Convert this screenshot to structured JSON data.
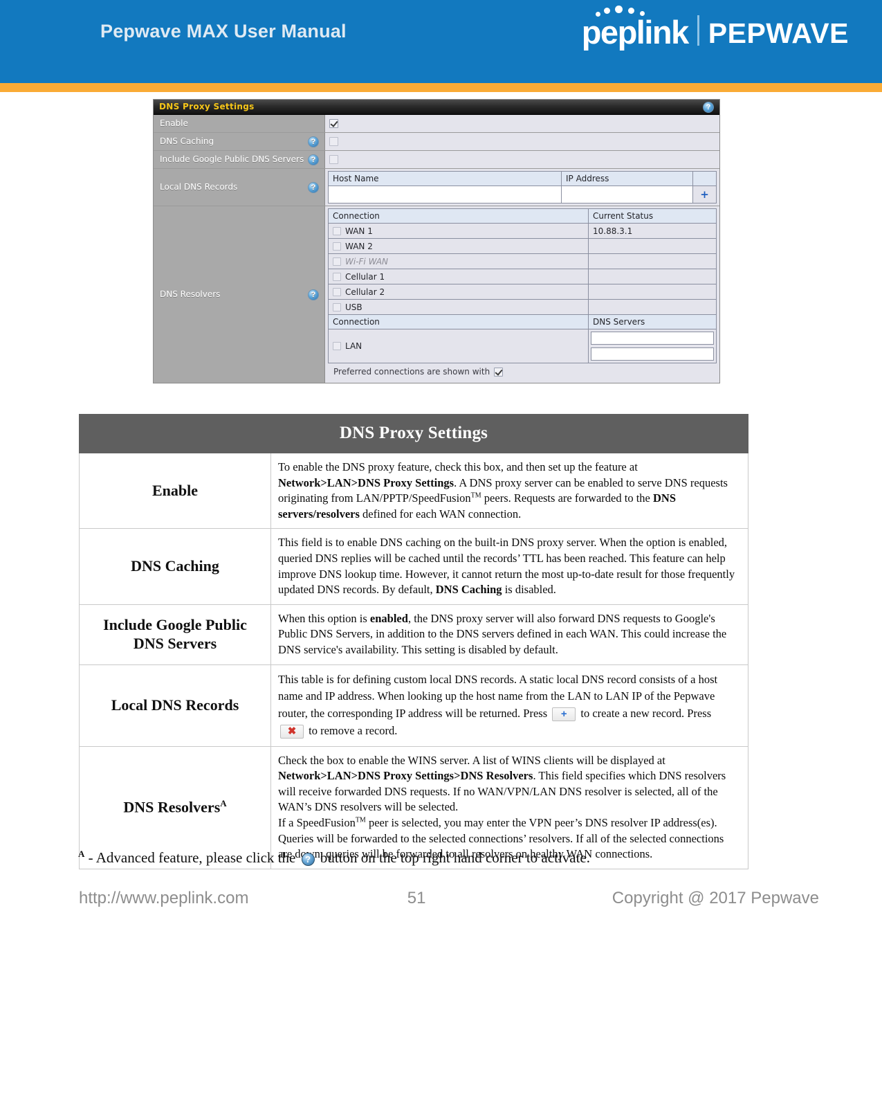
{
  "header": {
    "title": "Pepwave MAX User Manual",
    "brand_primary": "peplink",
    "brand_secondary": "PEPWAVE",
    "bar_color": "#1279bf",
    "accent_color": "#faab36"
  },
  "screenshot": {
    "panel_title": "DNS Proxy Settings",
    "help_icon": "question-mark-icon",
    "rows": {
      "enable": {
        "label": "Enable",
        "checked": true
      },
      "dns_caching": {
        "label": "DNS Caching",
        "checked": false
      },
      "include_google": {
        "label": "Include Google Public DNS Servers",
        "checked": false
      },
      "local_dns_records": {
        "label": "Local DNS Records"
      },
      "dns_resolvers": {
        "label": "DNS Resolvers"
      }
    },
    "local_records_table": {
      "columns": [
        "Host Name",
        "IP Address"
      ],
      "host_name_value": "",
      "ip_address_value": "",
      "add_icon": "plus-icon"
    },
    "resolvers_table": {
      "columns": [
        "Connection",
        "Current Status"
      ],
      "rows": [
        {
          "name": "WAN 1",
          "status": "10.88.3.1",
          "checked": false,
          "disabled": false
        },
        {
          "name": "WAN 2",
          "status": "",
          "checked": false,
          "disabled": false
        },
        {
          "name": "Wi-Fi WAN",
          "status": "",
          "checked": false,
          "disabled": true
        },
        {
          "name": "Cellular 1",
          "status": "",
          "checked": false,
          "disabled": false
        },
        {
          "name": "Cellular 2",
          "status": "",
          "checked": false,
          "disabled": false
        },
        {
          "name": "USB",
          "status": "",
          "checked": false,
          "disabled": false
        }
      ],
      "lan_columns": [
        "Connection",
        "DNS Servers"
      ],
      "lan_row": {
        "name": "LAN",
        "checked": false,
        "server_1": "",
        "server_2": ""
      },
      "footer_note": "Preferred connections are shown with"
    }
  },
  "doc_table": {
    "caption": "DNS Proxy Settings",
    "rows": [
      {
        "term": "Enable",
        "desc_parts": [
          {
            "t": "To enable the DNS proxy feature, check this box, and then set up the feature at ",
            "b": false
          },
          {
            "t": "Network>LAN>DNS Proxy Settings",
            "b": true
          },
          {
            "t": ". A DNS proxy server can be enabled to serve DNS requests originating from LAN/PPTP/SpeedFusion",
            "b": false
          },
          {
            "t": "TM",
            "sup": true
          },
          {
            "t": " peers. Requests are forwarded to the ",
            "b": false
          },
          {
            "t": "DNS servers/resolvers",
            "b": true
          },
          {
            "t": " defined for each WAN connection.",
            "b": false
          }
        ]
      },
      {
        "term": "DNS Caching",
        "desc_parts": [
          {
            "t": "This field is to enable DNS caching on the built-in DNS proxy server. When the option is enabled, queried DNS replies will be cached until the records’ TTL has been reached. This feature can help improve DNS lookup time. However, it cannot return the most up-to-date result for those frequently updated DNS records. By default, ",
            "b": false
          },
          {
            "t": "DNS Caching",
            "b": true
          },
          {
            "t": " is disabled.",
            "b": false
          }
        ]
      },
      {
        "term": "Include Google Public DNS Servers",
        "desc_parts": [
          {
            "t": "When this option is ",
            "b": false
          },
          {
            "t": "enabled",
            "b": true
          },
          {
            "t": ", the DNS proxy server will also forward DNS requests to Google's Public DNS Servers, in addition to the DNS servers defined in each WAN. This could increase the DNS service's availability. This setting is disabled by default.",
            "b": false
          }
        ]
      },
      {
        "term": "Local DNS Records",
        "desc_parts": [
          {
            "t": "This table is for defining custom local DNS records. A static local DNS record consists of a host name and IP address. When looking up the host name from the LAN to LAN IP of the Pepwave router, the corresponding IP address will be returned. Press ",
            "b": false
          },
          {
            "icon": "plus-button-icon"
          },
          {
            "t": " to create a new record. Press ",
            "b": false
          },
          {
            "icon": "delete-button-icon"
          },
          {
            "t": " to remove a record.",
            "b": false
          }
        ]
      },
      {
        "term": "DNS Resolvers",
        "term_mark": "A",
        "desc_parts": [
          {
            "t": "Check the box to enable the WINS server. A list of WINS clients will be displayed at ",
            "b": false
          },
          {
            "t": "Network>LAN>DNS Proxy Settings>DNS Resolvers",
            "b": true
          },
          {
            "t": ". This field specifies which DNS resolvers will receive forwarded DNS requests. If no WAN/VPN/LAN DNS resolver is selected, all of the WAN’s DNS resolvers will be selected.",
            "b": false
          },
          {
            "br": true
          },
          {
            "t": "If a SpeedFusion",
            "b": false
          },
          {
            "t": "TM",
            "sup": true
          },
          {
            "t": " peer is selected, you may enter the VPN peer’s DNS resolver IP address(es). Queries will be forwarded to the selected connections’ resolvers. If all of the selected connections are down, queries will be forwarded to all resolvers on healthy WAN connections.",
            "b": false
          }
        ]
      }
    ]
  },
  "footnote": {
    "mark": "A",
    "text_before": " - Advanced feature, please click the ",
    "icon": "help-button-icon",
    "text_after": " button on the top right hand corner to activate."
  },
  "footer": {
    "url": "http://www.peplink.com",
    "page_number": "51",
    "copyright": "Copyright @ 2017 Pepwave"
  }
}
